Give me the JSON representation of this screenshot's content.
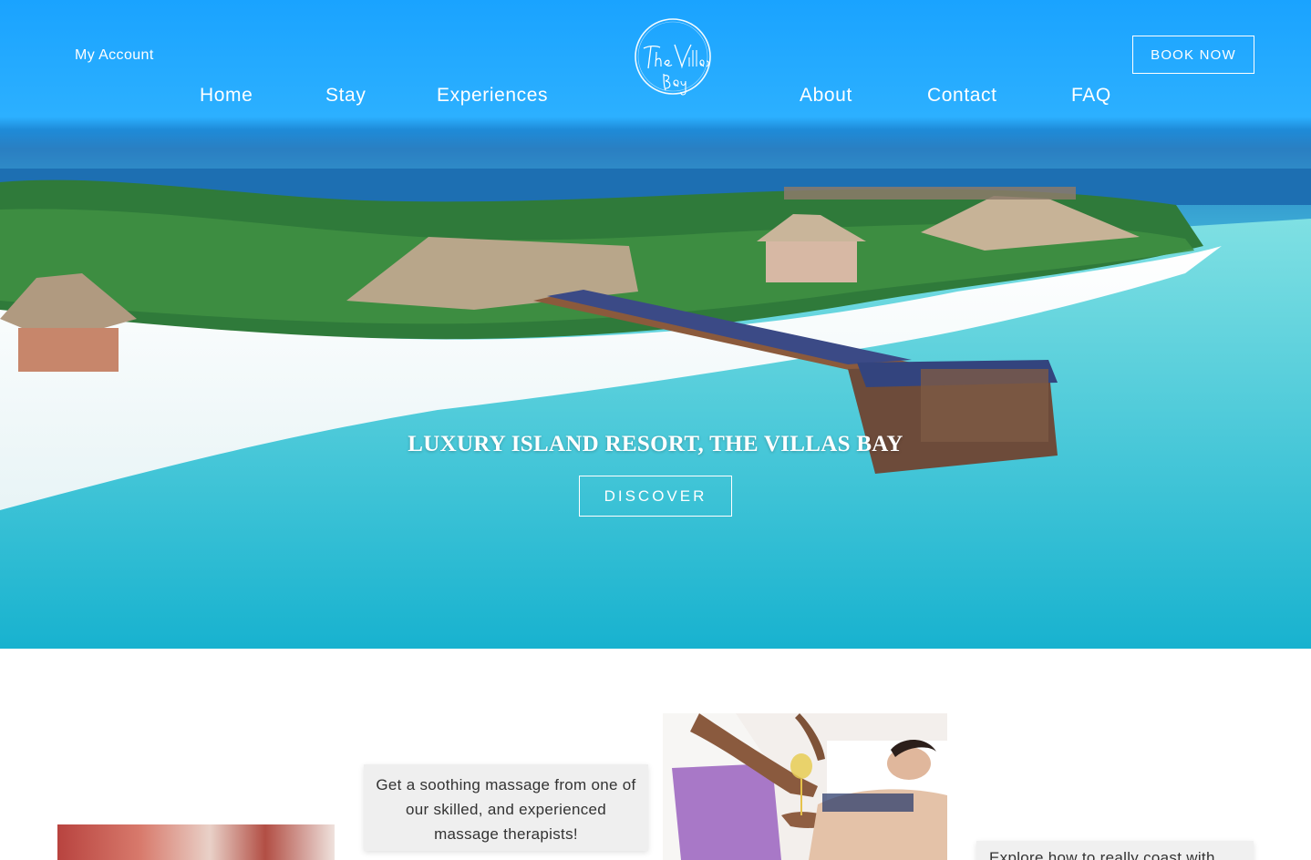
{
  "header": {
    "my_account": "My Account",
    "book_now": "BOOK NOW",
    "nav": {
      "home": "Home",
      "stay": "Stay",
      "experiences": "Experiences",
      "about": "About",
      "contact": "Contact",
      "faq": "FAQ"
    },
    "logo_text": "The Villas Bay"
  },
  "hero": {
    "title": "LUXURY ISLAND RESORT, THE VILLAS BAY",
    "button": "DISCOVER"
  },
  "features": {
    "massage_caption": "Get a soothing massage from one of our skilled, and experienced massage therapists!",
    "right_caption": "Explore how to really coast with"
  }
}
